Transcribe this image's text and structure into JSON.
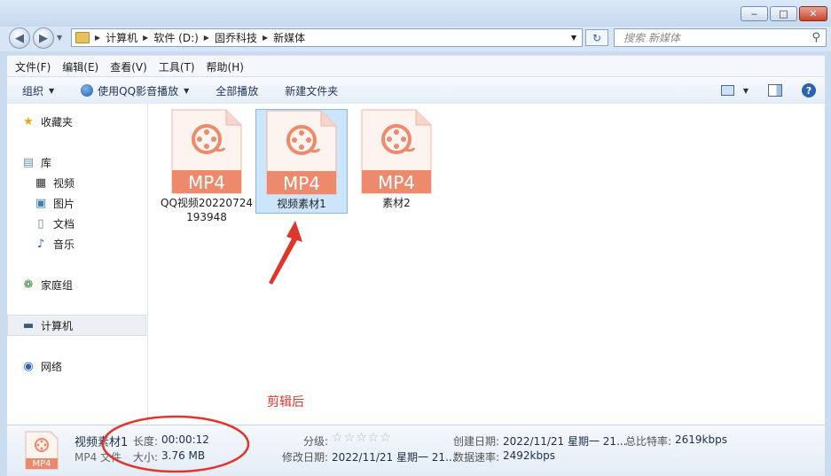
{
  "window": {
    "minimize": "‒",
    "maximize": "□",
    "close": "✕"
  },
  "address": {
    "crumbs": [
      "计算机",
      "软件 (D:)",
      "固乔科技",
      "新媒体"
    ],
    "search_placeholder": "搜索 新媒体"
  },
  "menu": [
    "文件(F)",
    "编辑(E)",
    "查看(V)",
    "工具(T)",
    "帮助(H)"
  ],
  "toolbar": {
    "organize": "组织",
    "play_with": "使用QQ影音播放",
    "play_all": "全部播放",
    "new_folder": "新建文件夹"
  },
  "nav": {
    "favorites": "收藏夹",
    "library": "库",
    "videos": "视频",
    "pictures": "图片",
    "documents": "文档",
    "music": "音乐",
    "homegroup": "家庭组",
    "computer": "计算机",
    "network": "网络"
  },
  "files": [
    {
      "icon_label": "MP4",
      "name": "QQ视频20220724193948",
      "selected": false
    },
    {
      "icon_label": "MP4",
      "name": "视频素材1",
      "selected": true
    },
    {
      "icon_label": "MP4",
      "name": "素材2",
      "selected": false
    }
  ],
  "annotation": "剪辑后",
  "details": {
    "icon_label": "MP4",
    "name": "视频素材1",
    "type": "MP4 文件",
    "length_label": "长度:",
    "length": "00:00:12",
    "size_label": "大小:",
    "size": "3.76 MB",
    "rating_label": "分级:",
    "rating_stars": "☆☆☆☆☆",
    "modified_label": "修改日期:",
    "modified": "2022/11/21 星期一 21...",
    "created_label": "创建日期:",
    "created": "2022/11/21 星期一 21...",
    "bitrate_label": "总比特率:",
    "bitrate": "2619kbps",
    "datarate_label": "数据速率:",
    "datarate": "2492kbps"
  },
  "colors": {
    "mp4_orange": "#ee8a6c",
    "annotation_red": "#e0352b",
    "selection": "#cce5fb"
  }
}
